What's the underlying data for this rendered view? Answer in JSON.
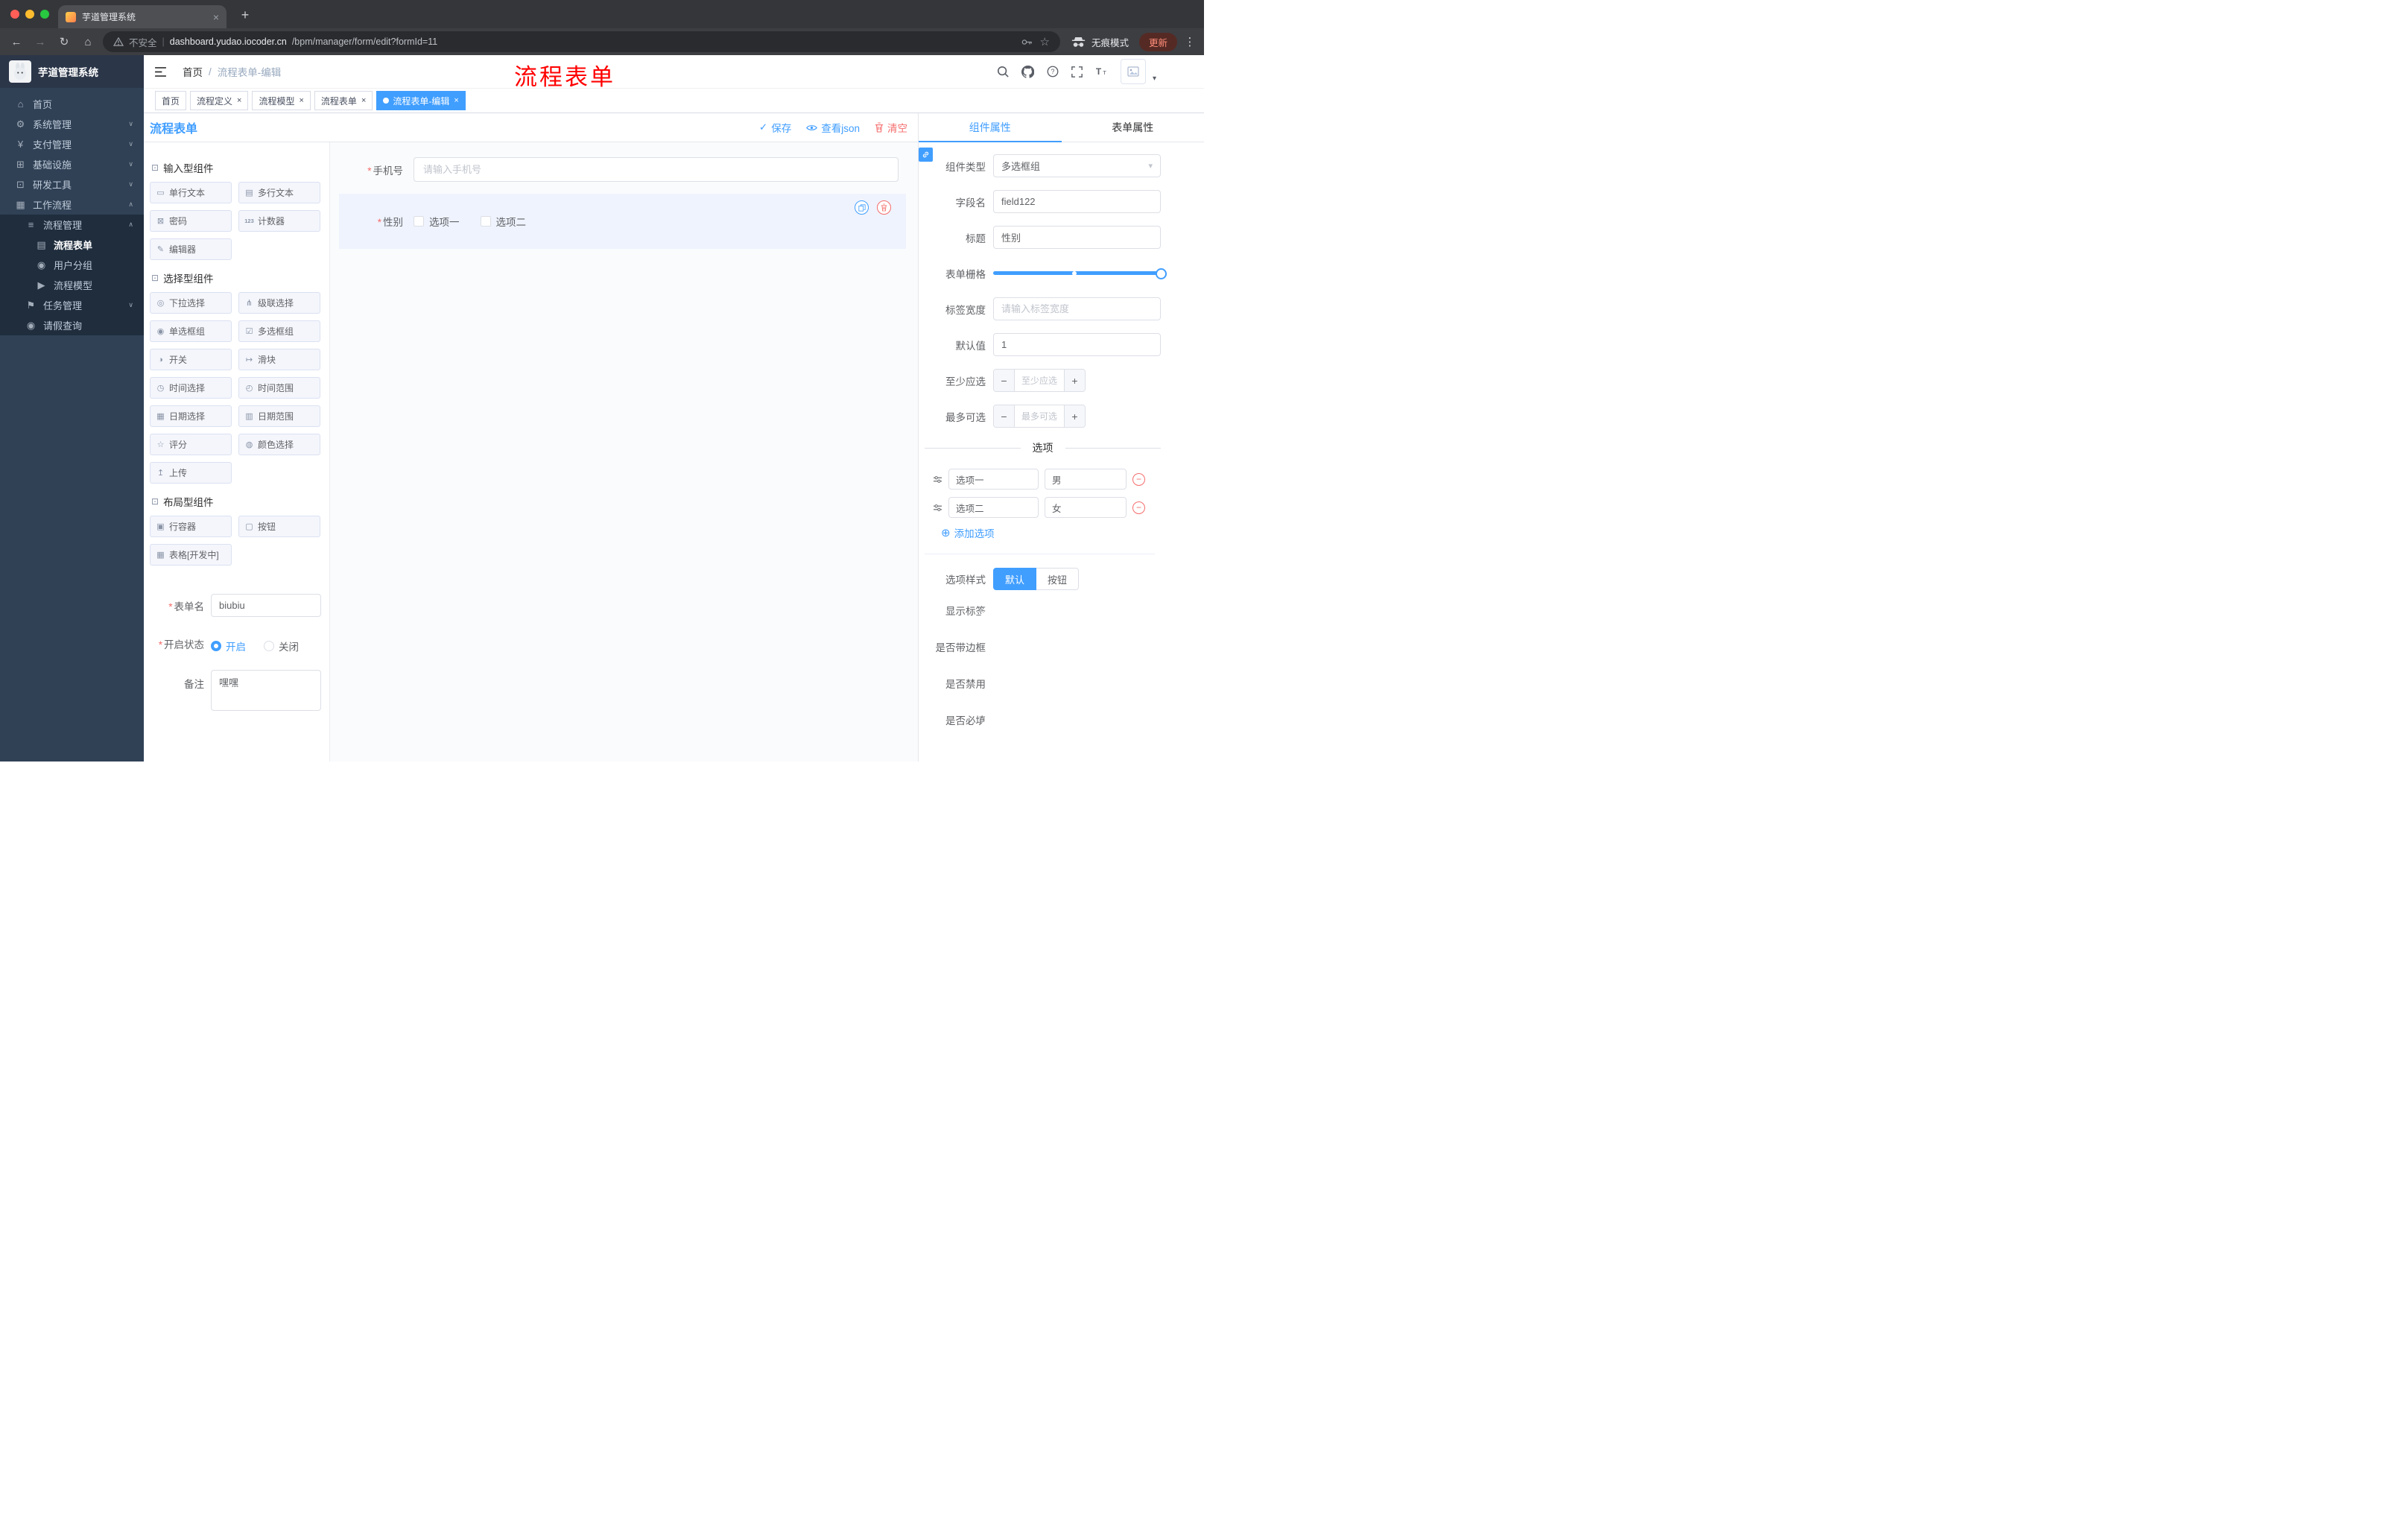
{
  "colors": {
    "accent": "#409eff",
    "danger": "#f56c6c",
    "sidebar_bg": "#304156",
    "annotation_red": "#ff0000",
    "tag_active_bg": "#409eff"
  },
  "browser": {
    "tab_title": "芋道管理系统",
    "close_glyph": "×",
    "new_tab_glyph": "+",
    "back_glyph": "←",
    "forward_glyph": "→",
    "reload_glyph": "↻",
    "home_glyph": "⌂",
    "security_label": "不安全",
    "omni_sep": "|",
    "url_host": "dashboard.yudao.iocoder.cn",
    "url_path": "/bpm/manager/form/edit?formId=11",
    "bookmark_star_glyph": "☆",
    "incognito_label": "无痕模式",
    "update_label": "更新",
    "menu_glyph": "⋮"
  },
  "sidebar": {
    "logo_title": "芋道管理系统",
    "items": [
      {
        "icon": "⌂",
        "label": "首页"
      },
      {
        "icon": "⚙",
        "label": "系统管理",
        "chevron": "∨"
      },
      {
        "icon": "¥",
        "label": "支付管理",
        "chevron": "∨"
      },
      {
        "icon": "⊞",
        "label": "基础设施",
        "chevron": "∨"
      },
      {
        "icon": "⊡",
        "label": "研发工具",
        "chevron": "∨"
      },
      {
        "icon": "▦",
        "label": "工作流程",
        "chevron": "∧"
      },
      {
        "icon": "≡",
        "label": "流程管理",
        "chevron": "∧"
      },
      {
        "icon": "▤",
        "label": "流程表单"
      },
      {
        "icon": "◉",
        "label": "用户分组"
      },
      {
        "icon": "▶",
        "label": "流程模型"
      },
      {
        "icon": "⚑",
        "label": "任务管理",
        "chevron": "∨"
      },
      {
        "icon": "◉",
        "label": "请假查询"
      }
    ]
  },
  "header": {
    "breadcrumb_home": "首页",
    "breadcrumb_sep": "/",
    "breadcrumb_current": "流程表单-编辑",
    "annotation": "流程表单",
    "avatar_caret": "▾"
  },
  "tags": {
    "close_glyph": "×",
    "items": [
      {
        "label": "首页"
      },
      {
        "label": "流程定义"
      },
      {
        "label": "流程模型"
      },
      {
        "label": "流程表单"
      },
      {
        "label": "流程表单-编辑"
      }
    ]
  },
  "designer": {
    "title": "流程表单",
    "actions": {
      "save_glyph": "✓",
      "save": "保存",
      "view_json": "查看json",
      "clear": "清空"
    },
    "palette": {
      "groups": [
        {
          "icon": "⊡",
          "title": "输入型组件",
          "items": [
            {
              "icon": "▭",
              "label": "单行文本"
            },
            {
              "icon": "▤",
              "label": "多行文本"
            },
            {
              "icon": "⊠",
              "label": "密码"
            },
            {
              "icon": "123",
              "label": "计数器"
            },
            {
              "icon": "✎",
              "label": "编辑器"
            }
          ]
        },
        {
          "icon": "⊡",
          "title": "选择型组件",
          "items": [
            {
              "icon": "◎",
              "label": "下拉选择"
            },
            {
              "icon": "⋔",
              "label": "级联选择"
            },
            {
              "icon": "◉",
              "label": "单选框组"
            },
            {
              "icon": "☑",
              "label": "多选框组"
            },
            {
              "icon": "◑",
              "label": "开关"
            },
            {
              "icon": "↦",
              "label": "滑块"
            },
            {
              "icon": "◷",
              "label": "时间选择"
            },
            {
              "icon": "◴",
              "label": "时间范围"
            },
            {
              "icon": "▦",
              "label": "日期选择"
            },
            {
              "icon": "▥",
              "label": "日期范围"
            },
            {
              "icon": "☆",
              "label": "评分"
            },
            {
              "icon": "◍",
              "label": "颜色选择"
            },
            {
              "icon": "↥",
              "label": "上传"
            }
          ]
        },
        {
          "icon": "⊡",
          "title": "布局型组件",
          "items": [
            {
              "icon": "▣",
              "label": "行容器"
            },
            {
              "icon": "▢",
              "label": "按钮"
            },
            {
              "icon": "▦",
              "label": "表格[开发中]"
            }
          ]
        }
      ]
    },
    "meta": {
      "form_name_label": "表单名",
      "form_name_value": "biubiu",
      "status_label": "开启状态",
      "status_on": "开启",
      "status_off": "关闭",
      "remark_label": "备注",
      "remark_value": "嘿嘿"
    },
    "canvas": {
      "phone_label": "手机号",
      "phone_placeholder": "请输入手机号",
      "gender_label": "性别",
      "gender_option1": "选项一",
      "gender_option2": "选项二"
    }
  },
  "props": {
    "tab_component": "组件属性",
    "tab_form": "表单属性",
    "component_type_label": "组件类型",
    "component_type_value": "多选框组",
    "select_caret": "▾",
    "field_name_label": "字段名",
    "field_name_value": "field122",
    "title_label": "标题",
    "title_value": "性别",
    "grid_label": "表单栅格",
    "label_width_label": "标签宽度",
    "label_width_placeholder": "请输入标签宽度",
    "default_label": "默认值",
    "default_value": "1",
    "min_label": "至少应选",
    "min_placeholder": "至少应选",
    "max_label": "最多可选",
    "max_placeholder": "最多可选",
    "minus_glyph": "−",
    "plus_glyph": "+",
    "options_divider": "选项",
    "options": [
      {
        "label": "选项一",
        "value": "男"
      },
      {
        "label": "选项二",
        "value": "女"
      }
    ],
    "remove_glyph": "−",
    "add_option_glyph": "⊕",
    "add_option": "添加选项",
    "style_label": "选项样式",
    "style_default": "默认",
    "style_button": "按钮",
    "switches": [
      {
        "label": "显示标签"
      },
      {
        "label": "是否带边框"
      },
      {
        "label": "是否禁用"
      },
      {
        "label": "是否必填"
      }
    ]
  }
}
